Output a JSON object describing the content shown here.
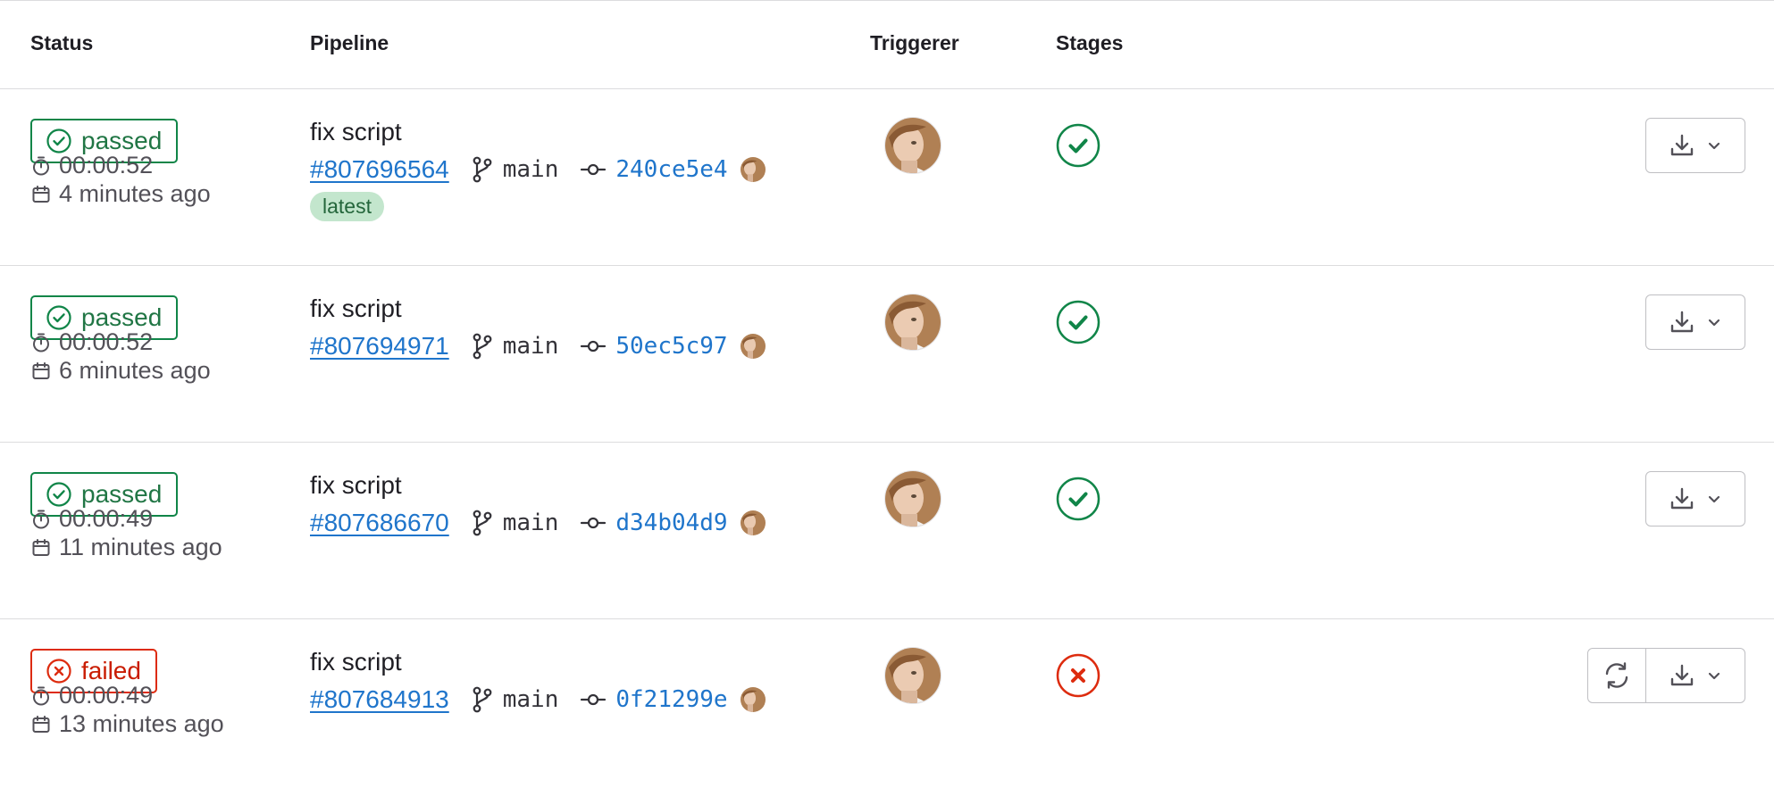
{
  "header": {
    "status": "Status",
    "pipeline": "Pipeline",
    "triggerer": "Triggerer",
    "stages": "Stages"
  },
  "pipelines": [
    {
      "status": "passed",
      "duration": "00:00:52",
      "finished": "4 minutes ago",
      "title": "fix script",
      "id": "#807696564",
      "branch": "main",
      "sha": "240ce5e4",
      "tag": "latest",
      "stage_status": "success",
      "actions": [
        "download-icon",
        "chevron-down-icon"
      ]
    },
    {
      "status": "passed",
      "duration": "00:00:52",
      "finished": "6 minutes ago",
      "title": "fix script",
      "id": "#807694971",
      "branch": "main",
      "sha": "50ec5c97",
      "stage_status": "success",
      "actions": [
        "download-icon",
        "chevron-down-icon"
      ]
    },
    {
      "status": "passed",
      "duration": "00:00:49",
      "finished": "11 minutes ago",
      "title": "fix script",
      "id": "#807686670",
      "branch": "main",
      "sha": "d34b04d9",
      "stage_status": "success",
      "actions": [
        "download-icon",
        "chevron-down-icon"
      ]
    },
    {
      "status": "failed",
      "duration": "00:00:49",
      "finished": "13 minutes ago",
      "title": "fix script",
      "id": "#807684913",
      "branch": "main",
      "sha": "0f21299e",
      "stage_status": "failed",
      "actions": [
        "retry-icon",
        "download-icon",
        "chevron-down-icon"
      ]
    }
  ],
  "colors": {
    "success": "#108548",
    "failed": "#dd2b0e",
    "link": "#1f75cb",
    "tag_bg": "#c3e6cd",
    "border": "#dcdcde"
  }
}
